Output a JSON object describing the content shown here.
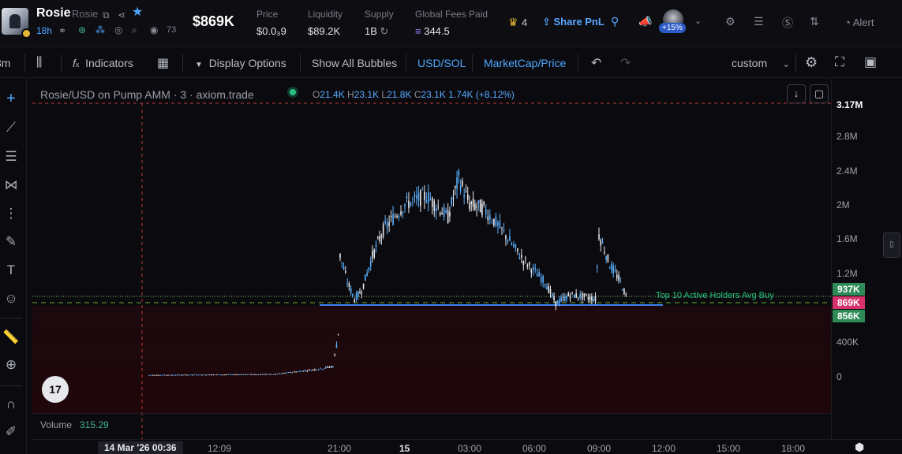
{
  "header": {
    "token_name": "Rosie",
    "token_subtitle": "Rosie",
    "age": "18h",
    "views": "73",
    "market_cap": "$869K",
    "stats": [
      {
        "label": "Price",
        "value": "$0.0₃9"
      },
      {
        "label": "Liquidity",
        "value": "$89.2K"
      },
      {
        "label": "Supply",
        "value": "1B"
      },
      {
        "label": "Global Fees Paid",
        "value": "344.5"
      }
    ],
    "crown_count": "4",
    "share_pnl": "Share PnL",
    "user_change": "+15%",
    "alert": "Alert"
  },
  "toolbar": {
    "interval": "3m",
    "indicators": "Indicators",
    "display_options": "Display Options",
    "show_all_bubbles": "Show All Bubbles",
    "currency": "USD/SOL",
    "mode": "MarketCap/Price",
    "layout": "custom"
  },
  "chart": {
    "legend_title": "Rosie/USD on Pump AMM · 3 · axiom.trade",
    "ohlc": {
      "o": "21.4K",
      "h": "23.1K",
      "l": "21.8K",
      "c": "23.1K",
      "change": "1.74K (+8.12%)"
    },
    "holders_label": "Top 10 Active Holders Avg Buy",
    "volume_label": "Volume",
    "volume_value": "315.29",
    "tv_logo": "17"
  },
  "price_axis": {
    "top_label": "3.17M",
    "ticks": [
      "2.8M",
      "2.4M",
      "2M",
      "1.6M",
      "1.2M",
      "400K",
      "0"
    ],
    "tags": [
      {
        "label": "937K",
        "color": "#2e8b57"
      },
      {
        "label": "869K",
        "color": "#d6336c"
      },
      {
        "label": "856K",
        "color": "#2e8b57"
      }
    ]
  },
  "time_axis": {
    "cursor": "14 Mar '26   00:36",
    "ticks": [
      "12:09",
      "21:00",
      "15",
      "03:00",
      "06:00",
      "09:00",
      "12:00",
      "15:00",
      "18:00"
    ]
  },
  "chart_data": {
    "type": "candlestick",
    "y_unit": "market cap (USD)",
    "ylim": [
      0,
      3170000
    ],
    "hlines": [
      {
        "value": 937000,
        "style": "dotted"
      },
      {
        "value": 869000,
        "style": "dashed"
      },
      {
        "value": 856000,
        "style": "solid"
      },
      {
        "value": 3170000,
        "style": "dashed"
      }
    ],
    "series": [
      {
        "x": [
          "12:09",
          "18:00",
          "20:00",
          "20:40",
          "20:55",
          "21:00",
          "21:20",
          "21:40",
          "22:00",
          "22:30",
          "23:00",
          "00:00",
          "01:00",
          "02:00",
          "02:30",
          "03:00",
          "03:40",
          "04:30",
          "05:30",
          "06:30",
          "07:00",
          "07:40",
          "08:30",
          "08:50",
          "09:00",
          "09:30",
          "10:00",
          "10:20"
        ],
        "values": [
          20000,
          30000,
          90000,
          120000,
          500000,
          1400000,
          1100000,
          900000,
          1000000,
          1400000,
          1700000,
          2000000,
          2100000,
          1850000,
          2300000,
          2000000,
          1950000,
          1700000,
          1350000,
          1100000,
          850000,
          950000,
          920000,
          900000,
          1650000,
          1300000,
          1100000,
          880000
        ]
      }
    ]
  }
}
